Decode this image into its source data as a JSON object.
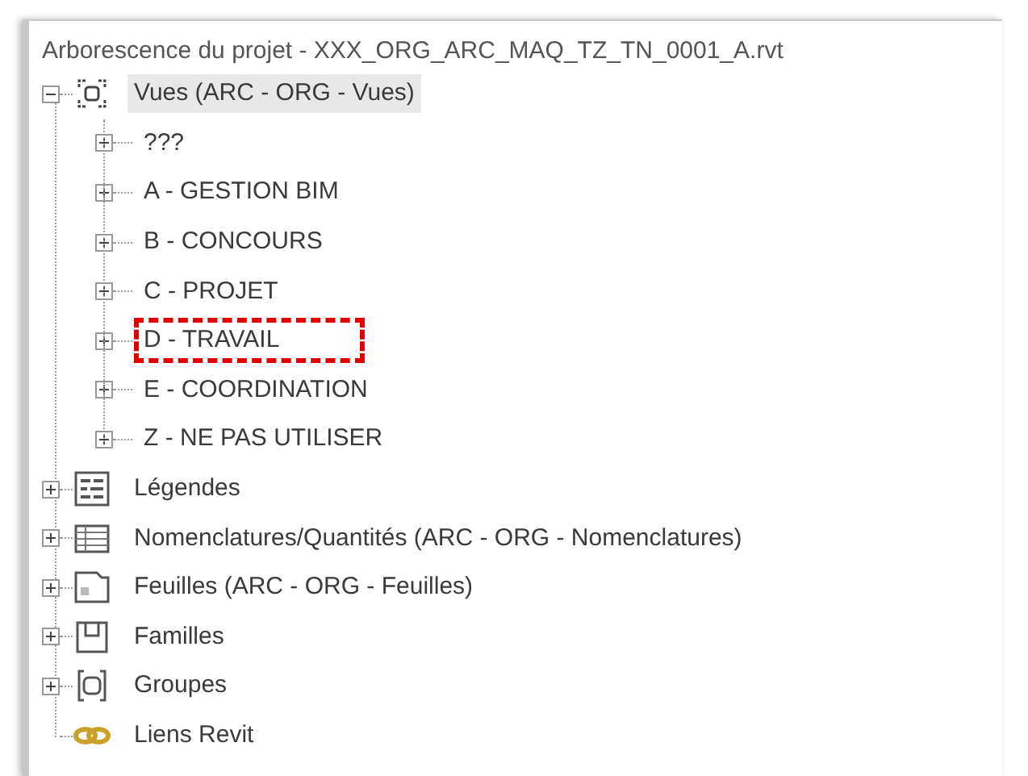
{
  "panel": {
    "title": "Arborescence du projet - XXX_ORG_ARC_MAQ_TZ_TN_0001_A.rvt"
  },
  "tree": [
    {
      "label": "Vues (ARC - ORG - Vues)",
      "kind": "views",
      "expanded": true,
      "selected": true,
      "children": [
        {
          "label": "???",
          "expanded": false,
          "highlighted": false
        },
        {
          "label": "A - GESTION BIM",
          "expanded": false,
          "highlighted": false
        },
        {
          "label": "B - CONCOURS",
          "expanded": false,
          "highlighted": false
        },
        {
          "label": "C - PROJET",
          "expanded": false,
          "highlighted": false
        },
        {
          "label": "D - TRAVAIL",
          "expanded": false,
          "highlighted": true
        },
        {
          "label": "E - COORDINATION",
          "expanded": false,
          "highlighted": false
        },
        {
          "label": "Z - NE PAS UTILISER",
          "expanded": false,
          "highlighted": false
        }
      ]
    },
    {
      "label": "Légendes",
      "kind": "legend",
      "expanded": false,
      "selected": false
    },
    {
      "label": "Nomenclatures/Quantités (ARC - ORG - Nomenclatures)",
      "kind": "schedule",
      "expanded": false,
      "selected": false
    },
    {
      "label": "Feuilles (ARC - ORG - Feuilles)",
      "kind": "sheet",
      "expanded": false,
      "selected": false
    },
    {
      "label": "Familles",
      "kind": "family",
      "expanded": false,
      "selected": false
    },
    {
      "label": "Groupes",
      "kind": "group",
      "expanded": false,
      "selected": false
    },
    {
      "label": "Liens Revit",
      "kind": "link",
      "selected": false
    }
  ]
}
